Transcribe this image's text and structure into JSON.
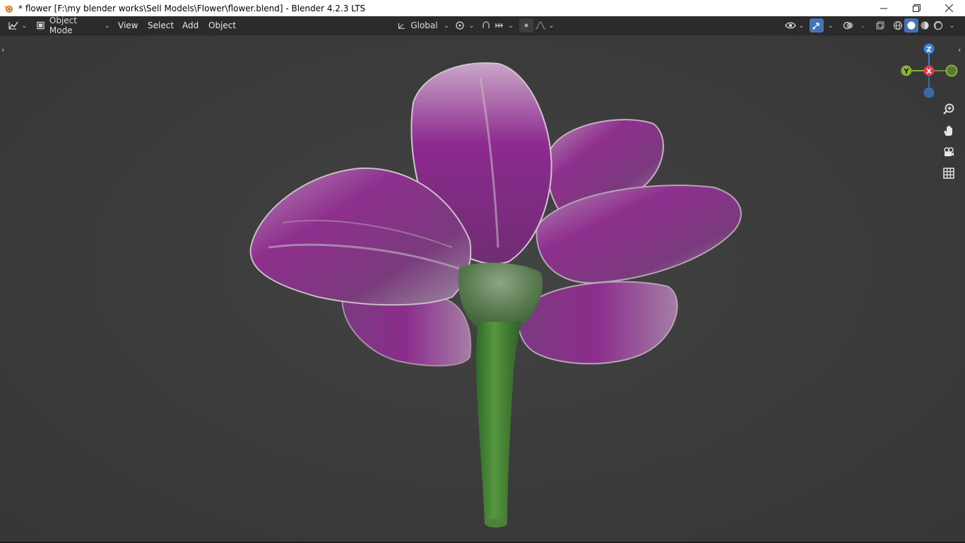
{
  "window": {
    "title": "* flower [F:\\my blender works\\Sell Models\\Flower\\flower.blend] - Blender 4.2.3 LTS",
    "minimize_icon": "minimize-icon",
    "maximize_icon": "restore-icon",
    "close_icon": "close-icon"
  },
  "header": {
    "editor_type_icon": "editor-type-icon",
    "mode_label": "Object Mode",
    "menus": [
      "View",
      "Select",
      "Add",
      "Object"
    ],
    "transform_orientation": "Global",
    "icons": [
      "pivot-icon",
      "snap-icon",
      "snap-target-icon",
      "proportional-editing-icon",
      "falloff-icon",
      "visibility-icon",
      "gizmo-icon",
      "overlay-icon",
      "xray-icon",
      "shading-wireframe-icon",
      "shading-solid-icon",
      "shading-material-icon",
      "shading-rendered-icon"
    ]
  },
  "viewport": {
    "gizmo_axes": {
      "z": "Z",
      "y": "Y",
      "x": "X"
    },
    "axis_colors": {
      "x": "#e0394f",
      "y": "#8bb23a",
      "z": "#3a80d6"
    },
    "nav_icons": [
      "zoom-icon",
      "pan-hand-icon",
      "camera-icon",
      "grid-icon"
    ]
  },
  "colors": {
    "header_bg": "#2b2b2b",
    "viewport_bg": "#3c3c3c",
    "active_toggle": "#4772b3",
    "petal_purple": "#8a2a8c",
    "stem_green": "#4a8a3a"
  }
}
